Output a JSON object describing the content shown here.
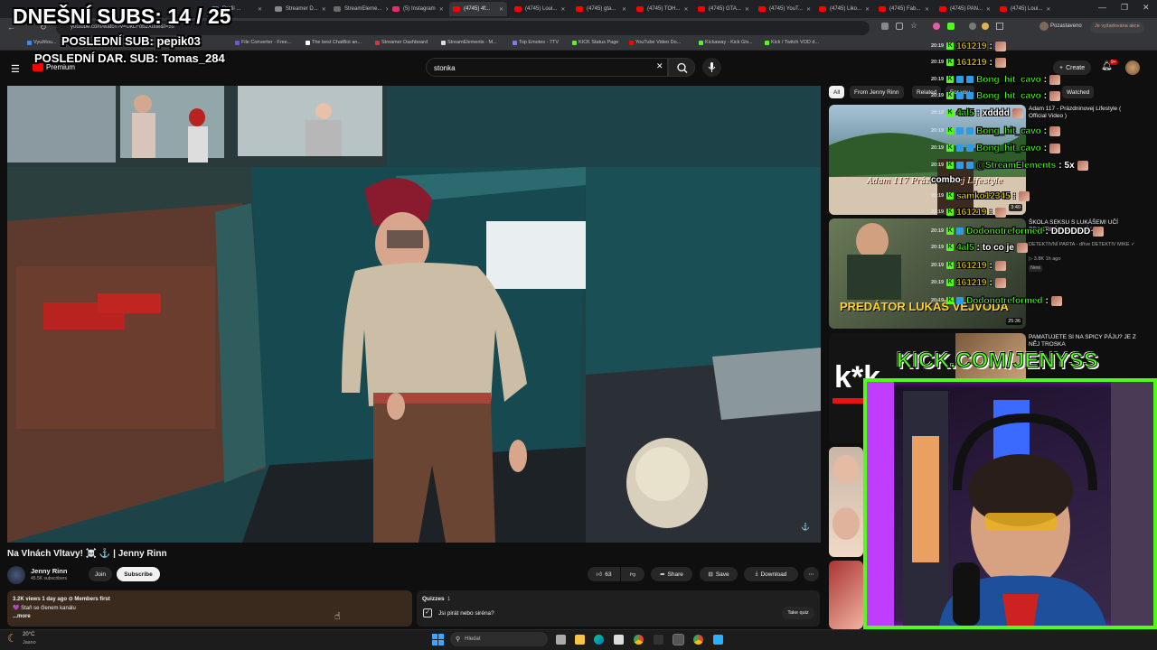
{
  "overlay": {
    "subs_goal": "DNEŠNÍ SUBS: 14 / 25",
    "last_sub": "POSLEDNÍ SUB: pepik03",
    "last_gift": "POSLEDNÍ DAR. SUB: Tomas_284",
    "kick_url": "KICK.COM/JENYSS"
  },
  "browser": {
    "tabs": [
      "",
      "",
      "Profil ...",
      "Streamer D...",
      "StreamEleme...",
      "(5) Instagram",
      "(4745) 4f...",
      "(4745) Loui...",
      "(4745) gta...",
      "(4745) TOH...",
      "(4745) GTA...",
      "(4745) YouT...",
      "(4745) Liko...",
      "(4745) Fab...",
      "(4745) PAN...",
      "(4745) Loui..."
    ],
    "url": "youtube.com/watch?v=UkLFob2Xutw&t=5s",
    "profile_label": "Pozastaveno",
    "update_label": "Je vyžadována akce",
    "bookmarks": [
      "Využitou...",
      "File Converter - Free...",
      "The best ChatBot an...",
      "Streamer Dashboard",
      "StreamElements - M...",
      "Top Emotes - 7TV",
      "KICK Status Page",
      "YouTube Video Do...",
      "Kickaway - Kick Giv...",
      "Kick / Twitch VOD d..."
    ]
  },
  "youtube": {
    "logo_suffix": "Premium",
    "search_value": "stonka",
    "create_label": "Create",
    "notif_count": "9+",
    "video_title": "Na Vlnách Vltavy! ☠️ ⚓ | Jenny Rinn",
    "channel_name": "Jenny Rinn",
    "subscriber_count": "45.5K subscribers",
    "join_label": "Join",
    "subscribe_label": "Subscribe",
    "like_count": "63",
    "share_label": "Share",
    "save_label": "Save",
    "download_label": "Download",
    "desc_stats": "3.2K views  1 day ago  ⊙ Members first",
    "desc_line": "💜 Staň se členem kanálu",
    "desc_more": "...more",
    "quizzes_title": "Quizzes",
    "quizzes_count": "1",
    "quiz_question": "Jsi pirát nebo siréna?",
    "take_quiz_label": "Take quiz",
    "chips": [
      "All",
      "From Jenny Rinn",
      "Related",
      "For you",
      "Watched"
    ],
    "related": [
      {
        "title": "Adam 117 - Prázdninovej Lifestyle ( Official Video )",
        "meta": "",
        "duration": "3:40",
        "thumb_text": "Adam 117 Prázdninovej Lifestyle"
      },
      {
        "title": "ŠKOLA SEKSU S LUKÁŠEM! UČÍ PRAKTIKÁM NA KONÍKA",
        "meta": "DETEKTIVNÍ PARTA - dříve DETEKTIV MIKE ✓",
        "meta2": "▷ 3.8K  1h ago",
        "badge": "New",
        "duration": "25:36",
        "thumb_text": "PREDÁTOR LUKÁŠ VEJVODA"
      },
      {
        "title": "PAMATUJETE SI NA SPICY PÁJU? JE Z NĚJ TROSKA",
        "meta": "",
        "duration": "",
        "thumb_text": "k*k"
      }
    ]
  },
  "chat": [
    {
      "time": "20:19",
      "user": "161219",
      "color": "#ffe600",
      "msg": "",
      "badges": "k"
    },
    {
      "time": "20:19",
      "user": "161219",
      "color": "#ffe600",
      "msg": "",
      "badges": "k"
    },
    {
      "time": "20:19",
      "user": "Bong_hit_cavo",
      "color": "#53fc18",
      "msg": "",
      "badges": "kbb"
    },
    {
      "time": "20:19",
      "user": "Bong_hit_cavo",
      "color": "#53fc18",
      "msg": "",
      "badges": "kbb"
    },
    {
      "time": "20:19",
      "user": "4al5",
      "color": "#53fc18",
      "msg": "xdddd",
      "badges": "k"
    },
    {
      "time": "20:19",
      "user": "Bong_hit_cavo",
      "color": "#53fc18",
      "msg": "",
      "badges": "kbb"
    },
    {
      "time": "20:19",
      "user": "Bong_hit_cavo",
      "color": "#53fc18",
      "msg": "",
      "badges": "kbb"
    },
    {
      "time": "20:19",
      "user": "@StreamElements",
      "color": "#53fc18",
      "msg": "5x",
      "badges": "kbb",
      "wrap": "combo"
    },
    {
      "time": "20:19",
      "user": "samko12345",
      "color": "#ffe600",
      "msg": "",
      "badges": "k"
    },
    {
      "time": "20:19",
      "user": "161219",
      "color": "#ffe600",
      "msg": "",
      "badges": "k"
    },
    {
      "time": "20:19",
      "user": "Dodonotreformed",
      "color": "#53fc18",
      "msg": "DDDDDD",
      "badges": "kb"
    },
    {
      "time": "20:19",
      "user": "4al5",
      "color": "#53fc18",
      "msg": "to co je",
      "badges": "k"
    },
    {
      "time": "20:19",
      "user": "161219",
      "color": "#ffe600",
      "msg": "",
      "badges": "k"
    },
    {
      "time": "20:19",
      "user": "161219",
      "color": "#ffe600",
      "msg": "",
      "badges": "k"
    },
    {
      "time": "20:19",
      "user": "Dodonotreformed",
      "color": "#53fc18",
      "msg": "",
      "badges": "kb"
    }
  ],
  "taskbar": {
    "weather_temp": "20°C",
    "weather_desc": "Jasno",
    "search_placeholder": "Hledat"
  }
}
